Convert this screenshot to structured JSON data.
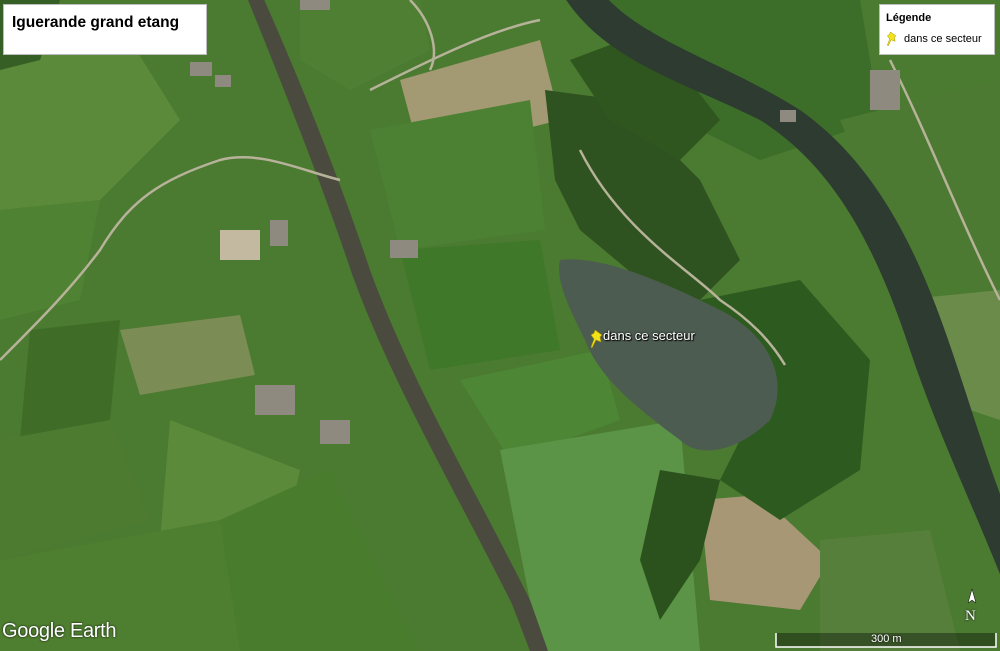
{
  "map": {
    "title": "Iguerande grand etang",
    "legend_title": "Légende",
    "legend_item": "dans ce secteur",
    "pin_label": "dans ce secteur",
    "pin_icon": "yellow-pushpin-icon",
    "watermark": "Google Earth",
    "scale_label": "300 m",
    "north_label": "N",
    "colors": {
      "field": "#4a7a32",
      "river": "#2e3e34",
      "pond": "#4c5c50",
      "canal": "#4d4b43",
      "pin": "#f2e21a"
    }
  }
}
